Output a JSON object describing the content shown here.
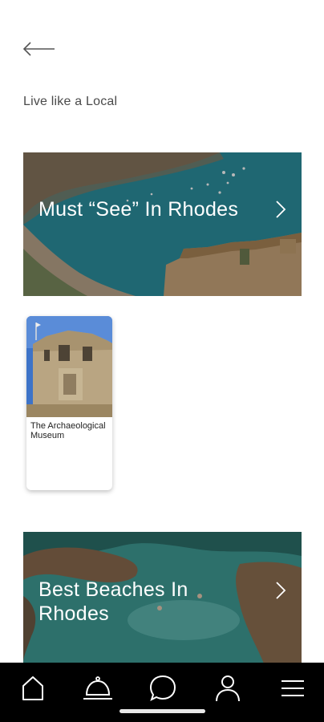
{
  "header": {
    "subtitle": "Live like a Local"
  },
  "sections": [
    {
      "title": "Must “See” In Rhodes",
      "items": [
        {
          "label": "The Archaeological Museum"
        }
      ]
    },
    {
      "title_line1": "Best Beaches In",
      "title_line2": "Rhodes"
    }
  ],
  "nav": {
    "items": [
      {
        "icon": "home-icon"
      },
      {
        "icon": "concierge-bell-icon"
      },
      {
        "icon": "chat-bubble-icon"
      },
      {
        "icon": "profile-icon"
      },
      {
        "icon": "menu-icon"
      }
    ]
  },
  "colors": {
    "nav_background": "#000000",
    "page_background": "#ffffff",
    "sea": "#2a8a9a"
  }
}
